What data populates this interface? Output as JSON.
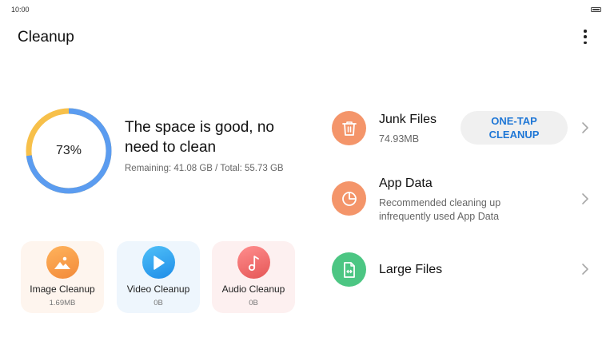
{
  "status_bar": {
    "time": "10:00"
  },
  "header": {
    "title": "Cleanup"
  },
  "storage": {
    "percent_label": "73%",
    "used_fraction": 0.73,
    "headline": "The space is good, no need to clean",
    "details": "Remaining: 41.08 GB / Total: 55.73 GB"
  },
  "categories": [
    {
      "label": "Image Cleanup",
      "size": "1.69MB",
      "icon": "image-icon"
    },
    {
      "label": "Video Cleanup",
      "size": "0B",
      "icon": "play-icon"
    },
    {
      "label": "Audio Cleanup",
      "size": "0B",
      "icon": "music-note-icon"
    }
  ],
  "items": {
    "junk": {
      "title": "Junk Files",
      "subtitle": "74.93MB",
      "button": "ONE-TAP CLEANUP",
      "icon": "trash-icon"
    },
    "app_data": {
      "title": "App Data",
      "subtitle": "Recommended cleaning up infrequently used App Data",
      "icon": "pie-chart-icon"
    },
    "large_files": {
      "title": "Large Files",
      "icon": "file-icon"
    }
  },
  "colors": {
    "ring_used": "#5b9cf0",
    "ring_free": "#f7c04a",
    "accent": "#1f77d6",
    "orange": "#f4956a",
    "green": "#4cc683"
  }
}
